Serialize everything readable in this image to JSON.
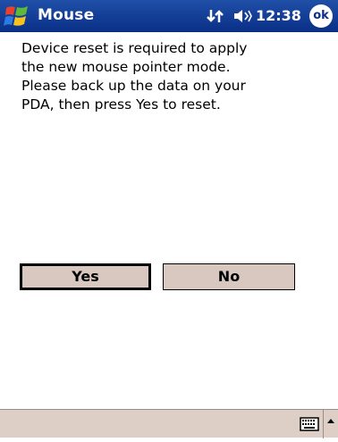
{
  "titlebar": {
    "app_title": "Mouse",
    "time": "12:38",
    "ok_label": "ok",
    "start_icon": "windows-flag-icon",
    "connectivity_icon": "connectivity-icon",
    "volume_icon": "speaker-icon"
  },
  "dialog": {
    "message_lines": [
      "Device reset is required to apply",
      "the new mouse pointer mode.",
      "Please back up the data on your",
      "PDA, then press Yes to reset."
    ],
    "yes_label": "Yes",
    "no_label": "No"
  },
  "bottombar": {
    "keyboard_icon": "keyboard-icon",
    "sip_arrow_icon": "caret-up-icon"
  },
  "colors": {
    "titlebar": "#0a2f86",
    "button_bg": "#d8c8c0",
    "bottombar_bg": "#ddcfc6"
  }
}
